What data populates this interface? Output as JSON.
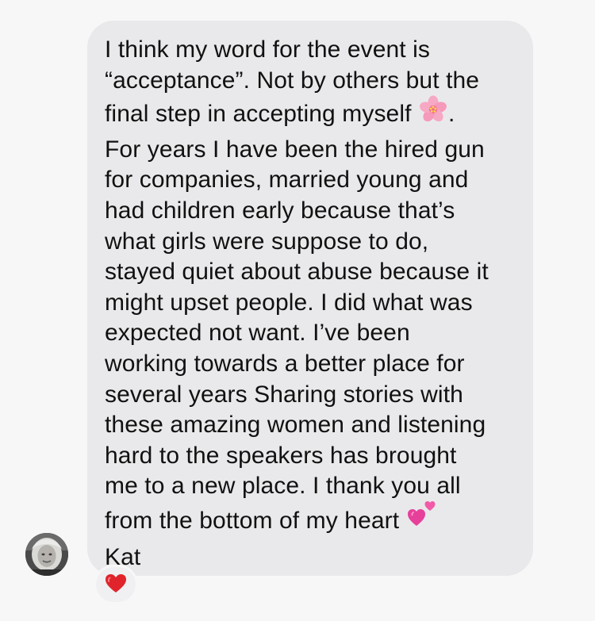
{
  "message": {
    "lines": [
      "I think my word for the event is",
      "“acceptance”. Not by others but the",
      "final step in accepting myself",
      "For years I have been the hired gun",
      "for companies, married young and",
      "had children early because that’s",
      "what girls were suppose to do,",
      "stayed quiet about abuse because it",
      "might upset people. I did what was",
      "expected not want. I’ve been",
      "working towards a better place for",
      "several years Sharing stories with",
      "these amazing women and listening",
      "hard to the speakers has brought",
      "me to a new place. I thank you all",
      "from the bottom of my heart"
    ],
    "after_flower": ".",
    "signature": "Kat",
    "icons": {
      "inline_1": "cherry-blossom-icon",
      "inline_2": "two-hearts-icon"
    }
  },
  "sender": {
    "avatar_icon": "avatar"
  },
  "reaction": {
    "icon": "red-heart-icon",
    "color": "#e0242b"
  },
  "colors": {
    "background": "#f7f7f8",
    "bubble": "#e9e9eb",
    "text": "#111111"
  }
}
